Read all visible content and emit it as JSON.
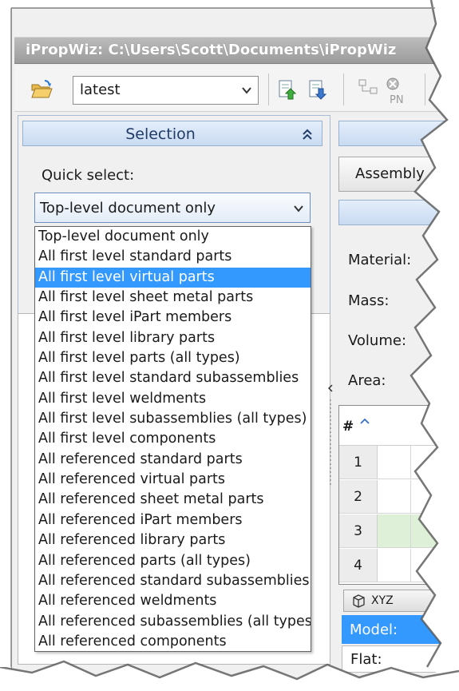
{
  "window": {
    "title": "iPropWiz: C:\\Users\\Scott\\Documents\\iPropWiz"
  },
  "toolbar": {
    "open_icon": "folder-open-icon",
    "config_value": "latest",
    "tool_icons": [
      "export-up-icon",
      "export-down-icon",
      "part-number-icon"
    ]
  },
  "selection": {
    "header": "Selection",
    "collapse_icon": "double-chevron-up-icon",
    "quick_select_label": "Quick select:",
    "quick_select_value": "Top-level document only",
    "options": [
      "Top-level document only",
      "All first level standard parts",
      "All first level virtual parts",
      "All first level sheet metal parts",
      "All first level iPart members",
      "All first level library parts",
      "All first level parts (all types)",
      "All first level standard subassemblies",
      "All first level weldments",
      "All first level subassemblies (all types)",
      "All first level components",
      "All referenced standard parts",
      "All referenced virtual parts",
      "All referenced sheet metal parts",
      "All referenced iPart members",
      "All referenced library parts",
      "All referenced parts (all types)",
      "All referenced standard subassemblies",
      "All referenced weldments",
      "All referenced subassemblies (all types)",
      "All referenced components"
    ],
    "highlighted_index": 2
  },
  "right": {
    "assembly_button": "Assembly",
    "props": [
      "Material:",
      "Mass:",
      "Volume:",
      "Area:"
    ],
    "grid_header": "#",
    "rows": [
      "1",
      "2",
      "3",
      "4"
    ],
    "highlight_row": 2,
    "tab_label": "XYZ",
    "model_label": "Model:",
    "flat_label": "Flat:"
  },
  "colors": {
    "selection_blue": "#3399ff",
    "header_gradient_top": "#e4eefb",
    "row_highlight_green": "#dff0d8"
  }
}
